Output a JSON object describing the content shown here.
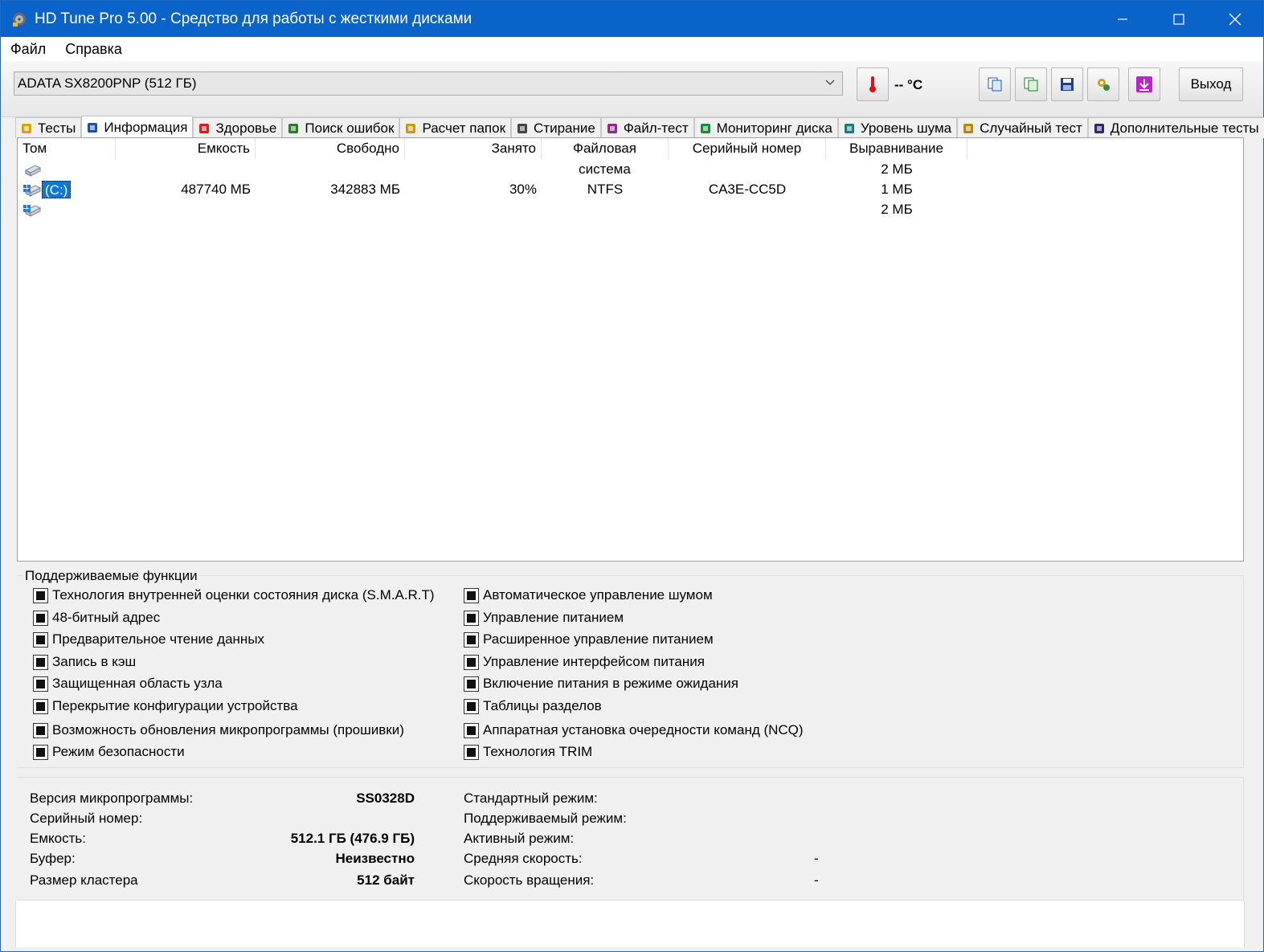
{
  "window": {
    "title": "HD Tune Pro 5.00 - Средство для работы с жесткими дисками"
  },
  "menu": {
    "file": "Файл",
    "help": "Справка"
  },
  "toolbar": {
    "drive": "ADATA SX8200PNP (512 ГБ)",
    "temperature": "-- °C",
    "exit_label": "Выход"
  },
  "tabs": [
    {
      "label": "Тесты",
      "icon": "bulb-icon"
    },
    {
      "label": "Информация",
      "icon": "info-icon"
    },
    {
      "label": "Здоровье",
      "icon": "health-cross-icon"
    },
    {
      "label": "Поиск ошибок",
      "icon": "magnifier-icon"
    },
    {
      "label": "Расчет папок",
      "icon": "folder-icon"
    },
    {
      "label": "Стирание",
      "icon": "trash-icon"
    },
    {
      "label": "Файл-тест",
      "icon": "file-test-icon"
    },
    {
      "label": "Мониторинг диска",
      "icon": "monitor-chart-icon"
    },
    {
      "label": "Уровень шума",
      "icon": "speaker-icon"
    },
    {
      "label": "Случайный тест",
      "icon": "random-chart-icon"
    },
    {
      "label": "Дополнительные тесты",
      "icon": "extra-tests-icon"
    }
  ],
  "volumes": {
    "columns": [
      "Том",
      "Емкость",
      "Свободно",
      "Занято",
      "Файловая система",
      "Серийный номер",
      "Выравнивание"
    ],
    "rows": [
      {
        "name": "",
        "capacity": "",
        "free": "",
        "used": "",
        "fs": "",
        "serial": "",
        "align": "2 МБ"
      },
      {
        "name": "(C:)",
        "capacity": "487740 МБ",
        "free": "342883 МБ",
        "used": "30%",
        "fs": "NTFS",
        "serial": "CA3E-CC5D",
        "align": "1 МБ"
      },
      {
        "name": "",
        "capacity": "",
        "free": "",
        "used": "",
        "fs": "",
        "serial": "",
        "align": "2 МБ"
      }
    ]
  },
  "features": {
    "title": "Поддерживаемые функции",
    "left": [
      "Технология внутренней оценки состояния диска (S.M.A.R.T)",
      "48-битный адрес",
      "Предварительное чтение данных",
      "Запись в кэш",
      "Защищенная область узла",
      "Перекрытие конфигурации устройства",
      "Возможность обновления микропрограммы (прошивки)",
      "Режим безопасности"
    ],
    "right": [
      "Автоматическое управление шумом",
      "Управление питанием",
      "Расширенное управление питанием",
      "Управление интерфейсом питания",
      "Включение питания в режиме ожидания",
      "Таблицы разделов",
      "Аппаратная установка очередности команд (NCQ)",
      "Технология TRIM"
    ]
  },
  "info": {
    "firmware_label": "Версия микропрограммы:",
    "firmware_value": "SS0328D",
    "serial_label": "Серийный номер:",
    "serial_value": "",
    "capacity_label": "Емкость:",
    "capacity_value": "512.1 ГБ (476.9 ГБ)",
    "buffer_label": "Буфер:",
    "buffer_value": "Неизвестно",
    "cluster_label": "Размер кластера",
    "cluster_value": "512 байт",
    "standard_label": "Стандартный режим:",
    "standard_value": "",
    "supported_label": "Поддерживаемый режим:",
    "supported_value": "",
    "active_label": "Активный режим:",
    "active_value": "",
    "avg_speed_label": "Средняя скорость:",
    "avg_speed_value": "-",
    "rotation_label": "Скорость вращения:",
    "rotation_value": "-"
  }
}
